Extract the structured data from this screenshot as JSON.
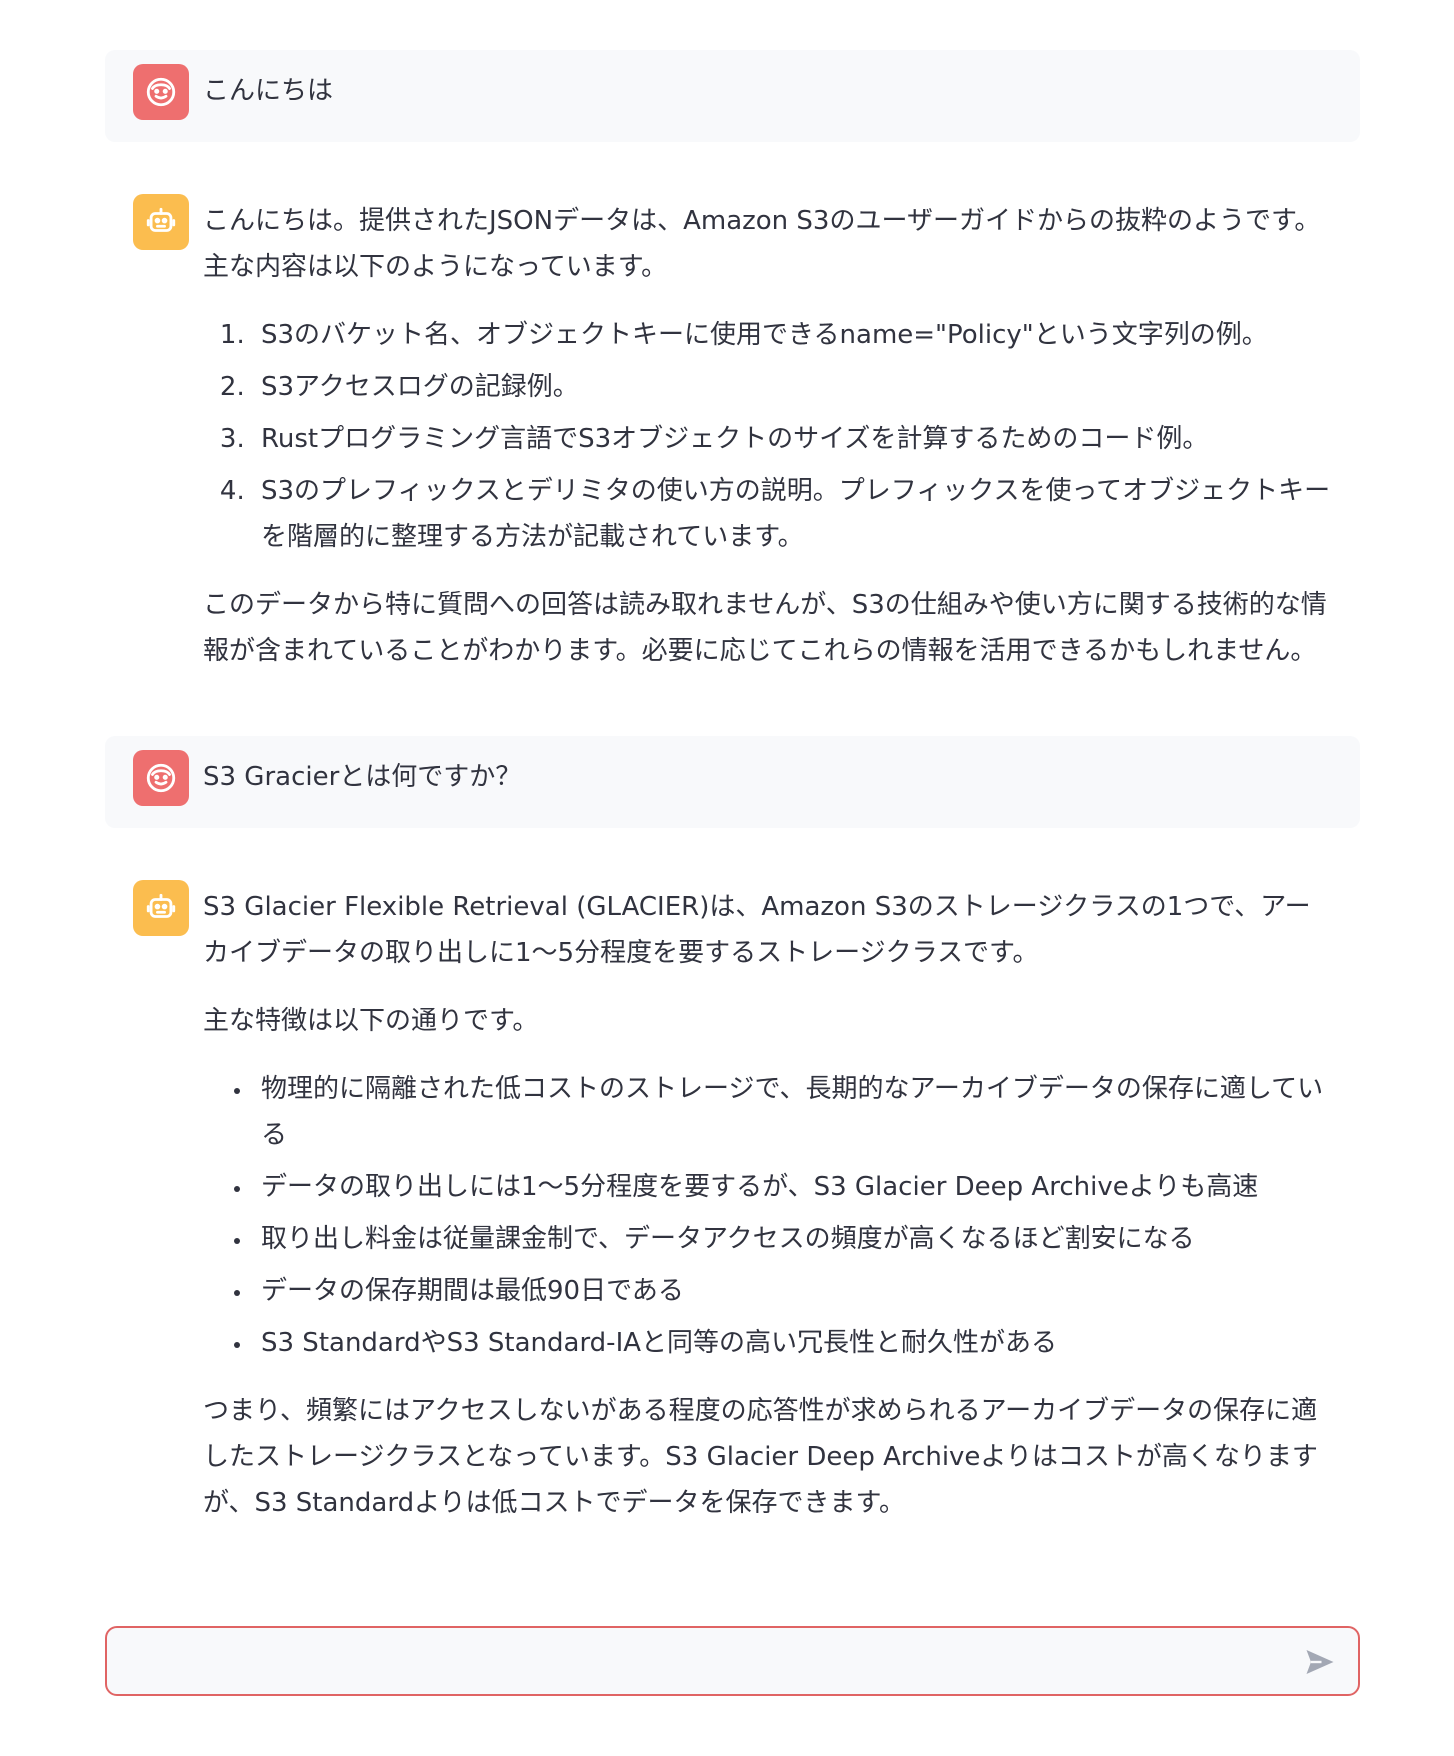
{
  "colors": {
    "user_avatar": "#ee6f6f",
    "assistant_avatar": "#fbbd4f",
    "user_bubble": "#f8f9fb",
    "input_border": "#e06464",
    "text": "#31333f"
  },
  "icons": {
    "user_avatar": "smiling-face-icon",
    "assistant_avatar": "robot-face-icon",
    "send": "send-arrow-icon"
  },
  "messages": [
    {
      "role": "user",
      "text": "こんにちは"
    },
    {
      "role": "assistant",
      "intro": "こんにちは。提供されたJSONデータは、Amazon S3のユーザーガイドからの抜粋のようです。主な内容は以下のようになっています。",
      "list": [
        "S3のバケット名、オブジェクトキーに使用できるname=\"Policy\"という文字列の例。",
        "S3アクセスログの記録例。",
        "Rustプログラミング言語でS3オブジェクトのサイズを計算するためのコード例。",
        "S3のプレフィックスとデリミタの使い方の説明。プレフィックスを使ってオブジェクトキーを階層的に整理する方法が記載されています。"
      ],
      "outro": "このデータから特に質問への回答は読み取れませんが、S3の仕組みや使い方に関する技術的な情報が含まれていることがわかります。必要に応じてこれらの情報を活用できるかもしれません。"
    },
    {
      "role": "user",
      "text": "S3 Gracierとは何ですか？"
    },
    {
      "role": "assistant",
      "intro": "S3 Glacier Flexible Retrieval (GLACIER)は、Amazon S3のストレージクラスの1つで、アーカイブデータの取り出しに1〜5分程度を要するストレージクラスです。",
      "lead": "主な特徴は以下の通りです。",
      "bullets": [
        "物理的に隔離された低コストのストレージで、長期的なアーカイブデータの保存に適している",
        "データの取り出しには1〜5分程度を要するが、S3 Glacier Deep Archiveよりも高速",
        "取り出し料金は従量課金制で、データアクセスの頻度が高くなるほど割安になる",
        "データの保存期間は最低90日である",
        "S3 StandardやS3 Standard-IAと同等の高い冗長性と耐久性がある"
      ],
      "outro": "つまり、頻繁にはアクセスしないがある程度の応答性が求められるアーカイブデータの保存に適したストレージクラスとなっています。S3 Glacier Deep Archiveよりはコストが高くなりますが、S3 Standardよりは低コストでデータを保存できます。"
    }
  ],
  "chat_input": {
    "value": "",
    "placeholder": ""
  }
}
